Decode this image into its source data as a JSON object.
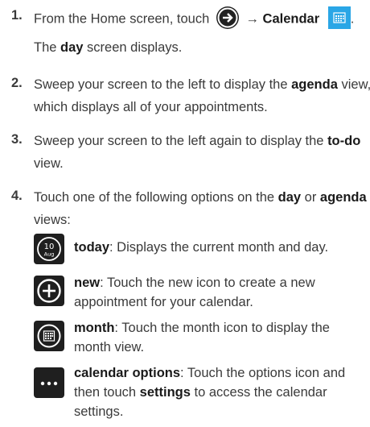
{
  "steps": [
    {
      "num": "1.",
      "lines": [
        {
          "pre": "From the Home screen, touch",
          "arrow": "→",
          "bold": "Calendar",
          "post": "."
        },
        {
          "pre": "The ",
          "bold": "day",
          "post": " screen displays."
        }
      ]
    },
    {
      "num": "2.",
      "lines": [
        {
          "pre": "Sweep your screen to the left to display the ",
          "bold": "agenda",
          "post": " view,"
        },
        {
          "pre": "which displays all of your appointments."
        }
      ]
    },
    {
      "num": "3.",
      "lines": [
        {
          "pre": "Sweep your screen to the left again to display the ",
          "bold": "to-do"
        },
        {
          "pre": "view."
        }
      ]
    },
    {
      "num": "4.",
      "lines": [
        {
          "pre": "Touch one of the following options on the ",
          "bold": "day",
          "mid": " or ",
          "bold2": "agenda"
        },
        {
          "pre": "views:"
        }
      ]
    }
  ],
  "options": [
    {
      "icon": "today-icon",
      "icon_top": "10",
      "icon_bottom": "Aug",
      "name": "today",
      "lines": [
        ": Displays the current month and day."
      ]
    },
    {
      "icon": "new-plus-icon",
      "name": "new",
      "lines": [
        ": Touch the new icon to create a new",
        "appointment for your calendar."
      ]
    },
    {
      "icon": "month-icon",
      "name": "month",
      "lines": [
        ": Touch the month icon to display the",
        "month view."
      ]
    },
    {
      "icon": "more-options-icon",
      "name": "calendar options",
      "lines": [
        ": Touch the options icon and",
        "then touch ",
        "settings",
        " to access the calendar",
        "settings."
      ]
    }
  ]
}
